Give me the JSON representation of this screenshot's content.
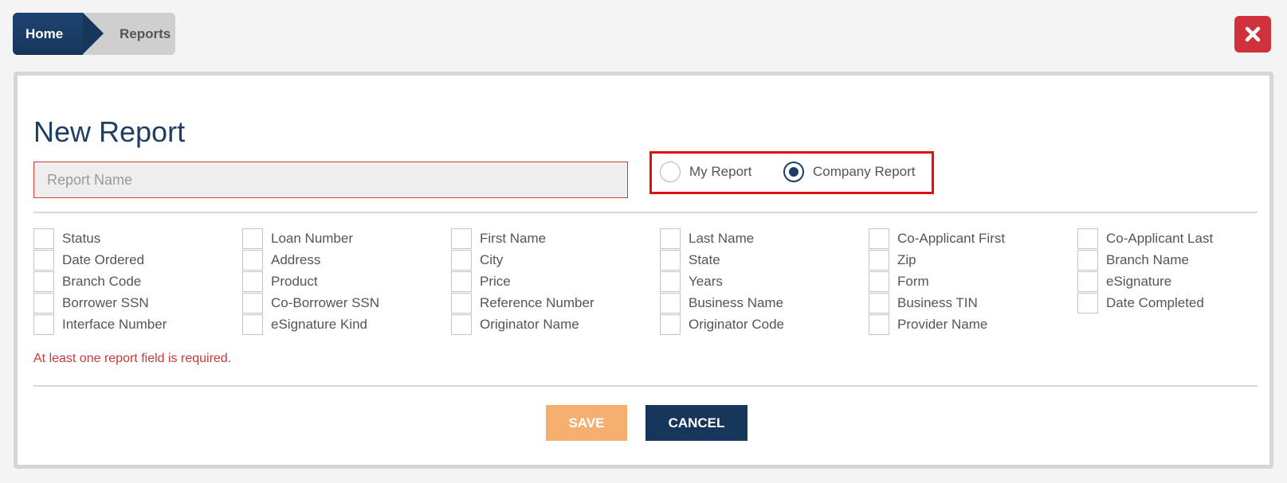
{
  "breadcrumb": {
    "home": "Home",
    "current": "Reports"
  },
  "close_icon": "close-x-icon",
  "form": {
    "title": "New Report",
    "report_name_placeholder": "Report Name",
    "report_name_value": "",
    "report_type": {
      "options": [
        "My Report",
        "Company Report"
      ],
      "selected": "Company Report"
    },
    "fields": [
      [
        "Status",
        "Date Ordered",
        "Branch Code",
        "Borrower SSN",
        "Interface Number"
      ],
      [
        "Loan Number",
        "Address",
        "Product",
        "Co-Borrower SSN",
        "eSignature Kind"
      ],
      [
        "First Name",
        "City",
        "Price",
        "Reference Number",
        "Originator Name"
      ],
      [
        "Last Name",
        "State",
        "Years",
        "Business Name",
        "Originator Code"
      ],
      [
        "Co-Applicant First",
        "Zip",
        "Form",
        "Business TIN",
        "Provider Name"
      ],
      [
        "Co-Applicant Last",
        "Branch Name",
        "eSignature",
        "Date Completed"
      ]
    ],
    "error": "At least one report field is required.",
    "save_label": "SAVE",
    "cancel_label": "CANCEL"
  },
  "colors": {
    "navy": "#17365c",
    "close_red": "#d0313a",
    "highlight_red": "#e01010",
    "save_orange": "#f5b06f",
    "error_red": "#c43a3a"
  }
}
